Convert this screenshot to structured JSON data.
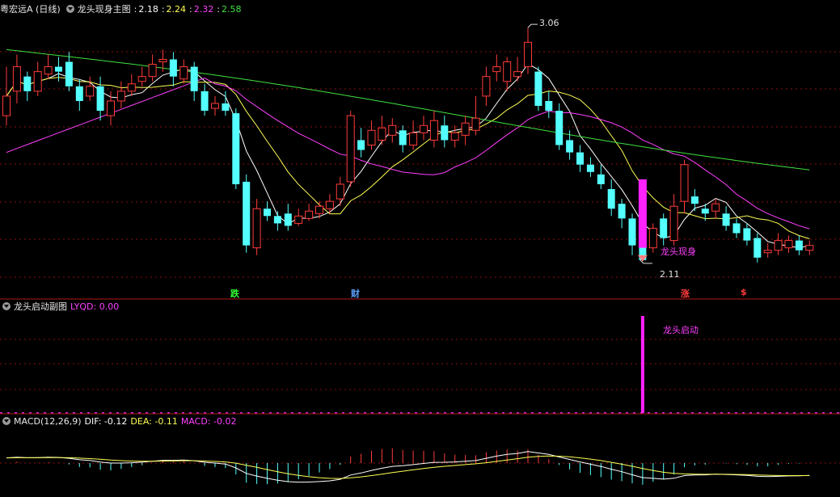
{
  "main_panel": {
    "stock_name": "粤宏远A (日线)",
    "indicator_name": "龙头现身主图",
    "values": [
      "2.18",
      "2.24",
      "2.32",
      "2.58"
    ],
    "high_label": "3.06",
    "low_label": "2.11",
    "signal_label": "龙头现身",
    "markers": [
      "跌",
      "财",
      "涨",
      "$"
    ]
  },
  "sub_panel_1": {
    "title": "龙头启动副图",
    "value_label": "LYQD: 0.00",
    "signal_label": "龙头启动"
  },
  "sub_panel_2": {
    "title": "MACD(12,26,9)",
    "dif_label": "DIF: -0.12",
    "dea_label": "DEA: -0.11",
    "macd_label": "MACD: -0.02"
  },
  "colors": {
    "up": "#ff3b3b",
    "down": "#54ffff",
    "ma1": "#ffffff",
    "ma2": "#ffff55",
    "ma3": "#ff40ff",
    "ma4": "#40e040",
    "signal": "#ff22ff"
  },
  "chart_data": {
    "type": "candlestick",
    "candles": [
      [
        2.7,
        2.78,
        2.9,
        2.66
      ],
      [
        2.8,
        2.9,
        2.95,
        2.75
      ],
      [
        2.86,
        2.8,
        2.88,
        2.76
      ],
      [
        2.8,
        2.88,
        2.92,
        2.78
      ],
      [
        2.87,
        2.9,
        2.95,
        2.85
      ],
      [
        2.9,
        2.88,
        2.94,
        2.84
      ],
      [
        2.92,
        2.82,
        2.96,
        2.8
      ],
      [
        2.82,
        2.76,
        2.85,
        2.72
      ],
      [
        2.78,
        2.82,
        2.86,
        2.76
      ],
      [
        2.82,
        2.72,
        2.86,
        2.68
      ],
      [
        2.7,
        2.76,
        2.8,
        2.66
      ],
      [
        2.76,
        2.8,
        2.84,
        2.73
      ],
      [
        2.8,
        2.83,
        2.87,
        2.78
      ],
      [
        2.84,
        2.86,
        2.9,
        2.82
      ],
      [
        2.86,
        2.91,
        2.95,
        2.84
      ],
      [
        2.92,
        2.93,
        2.97,
        2.88
      ],
      [
        2.93,
        2.86,
        2.96,
        2.82
      ],
      [
        2.85,
        2.9,
        2.93,
        2.83
      ],
      [
        2.9,
        2.8,
        2.92,
        2.76
      ],
      [
        2.8,
        2.72,
        2.83,
        2.7
      ],
      [
        2.73,
        2.75,
        2.78,
        2.7
      ],
      [
        2.75,
        2.72,
        2.8,
        2.7
      ],
      [
        2.71,
        2.42,
        2.73,
        2.4
      ],
      [
        2.43,
        2.17,
        2.46,
        2.14
      ],
      [
        2.16,
        2.32,
        2.36,
        2.13
      ],
      [
        2.32,
        2.29,
        2.35,
        2.27
      ],
      [
        2.29,
        2.26,
        2.31,
        2.23
      ],
      [
        2.3,
        2.25,
        2.34,
        2.23
      ],
      [
        2.26,
        2.29,
        2.32,
        2.25
      ],
      [
        2.28,
        2.31,
        2.34,
        2.27
      ],
      [
        2.3,
        2.33,
        2.35,
        2.28
      ],
      [
        2.32,
        2.35,
        2.38,
        2.3
      ],
      [
        2.36,
        2.42,
        2.45,
        2.33
      ],
      [
        2.43,
        2.7,
        2.72,
        2.41
      ],
      [
        2.6,
        2.56,
        2.65,
        2.53
      ],
      [
        2.58,
        2.64,
        2.68,
        2.56
      ],
      [
        2.6,
        2.65,
        2.7,
        2.58
      ],
      [
        2.62,
        2.66,
        2.69,
        2.59
      ],
      [
        2.64,
        2.58,
        2.66,
        2.55
      ],
      [
        2.58,
        2.63,
        2.68,
        2.56
      ],
      [
        2.63,
        2.66,
        2.7,
        2.6
      ],
      [
        2.6,
        2.68,
        2.72,
        2.57
      ],
      [
        2.66,
        2.6,
        2.7,
        2.57
      ],
      [
        2.6,
        2.63,
        2.66,
        2.57
      ],
      [
        2.62,
        2.67,
        2.7,
        2.58
      ],
      [
        2.64,
        2.69,
        2.78,
        2.62
      ],
      [
        2.78,
        2.86,
        2.9,
        2.74
      ],
      [
        2.88,
        2.9,
        2.95,
        2.84
      ],
      [
        2.84,
        2.92,
        2.94,
        2.8
      ],
      [
        2.86,
        2.88,
        2.94,
        2.84
      ],
      [
        2.9,
        3.0,
        3.06,
        2.87
      ],
      [
        2.88,
        2.74,
        2.9,
        2.72
      ],
      [
        2.76,
        2.72,
        2.8,
        2.69
      ],
      [
        2.72,
        2.58,
        2.75,
        2.56
      ],
      [
        2.6,
        2.55,
        2.64,
        2.52
      ],
      [
        2.55,
        2.5,
        2.58,
        2.47
      ],
      [
        2.5,
        2.47,
        2.53,
        2.45
      ],
      [
        2.46,
        2.42,
        2.5,
        2.4
      ],
      [
        2.4,
        2.32,
        2.44,
        2.29
      ],
      [
        2.34,
        2.28,
        2.36,
        2.24
      ],
      [
        2.28,
        2.17,
        2.3,
        2.13
      ],
      [
        2.18,
        2.11,
        2.2,
        2.11
      ],
      [
        2.16,
        2.24,
        2.26,
        2.14
      ],
      [
        2.28,
        2.2,
        2.3,
        2.17
      ],
      [
        2.19,
        2.33,
        2.38,
        2.17
      ],
      [
        2.35,
        2.5,
        2.52,
        2.3
      ],
      [
        2.37,
        2.34,
        2.4,
        2.31
      ],
      [
        2.32,
        2.3,
        2.34,
        2.27
      ],
      [
        2.31,
        2.34,
        2.36,
        2.28
      ],
      [
        2.3,
        2.25,
        2.33,
        2.23
      ],
      [
        2.26,
        2.22,
        2.28,
        2.2
      ],
      [
        2.24,
        2.19,
        2.26,
        2.17
      ],
      [
        2.2,
        2.12,
        2.22,
        2.1
      ],
      [
        2.14,
        2.15,
        2.18,
        2.12
      ],
      [
        2.15,
        2.19,
        2.22,
        2.13
      ],
      [
        2.16,
        2.19,
        2.21,
        2.14
      ],
      [
        2.19,
        2.15,
        2.21,
        2.13
      ],
      [
        2.15,
        2.17,
        2.19,
        2.13
      ]
    ],
    "ma_periods": [
      5,
      10,
      20,
      60
    ],
    "signal_bar_index": 61,
    "signal_bar_value": 1,
    "marker_indices": [
      21,
      33,
      63,
      68
    ],
    "macd": {
      "fast": 12,
      "slow": 26,
      "signal": 9
    }
  }
}
